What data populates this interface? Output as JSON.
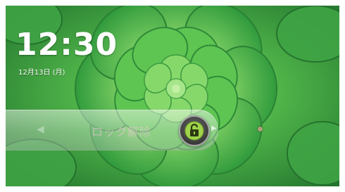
{
  "lockscreen": {
    "time": "12:30",
    "date": "12月13日 (月)",
    "unlock_hint": "ロック解除",
    "left_glyph": "◀",
    "arrow_glyph": "▶"
  },
  "colors": {
    "wallpaper_dark": "#1f6b2a",
    "wallpaper_light": "#7fd35a",
    "lock_green": "#9fd34a"
  },
  "icons": {
    "lock": "unlock-padlock-icon"
  }
}
